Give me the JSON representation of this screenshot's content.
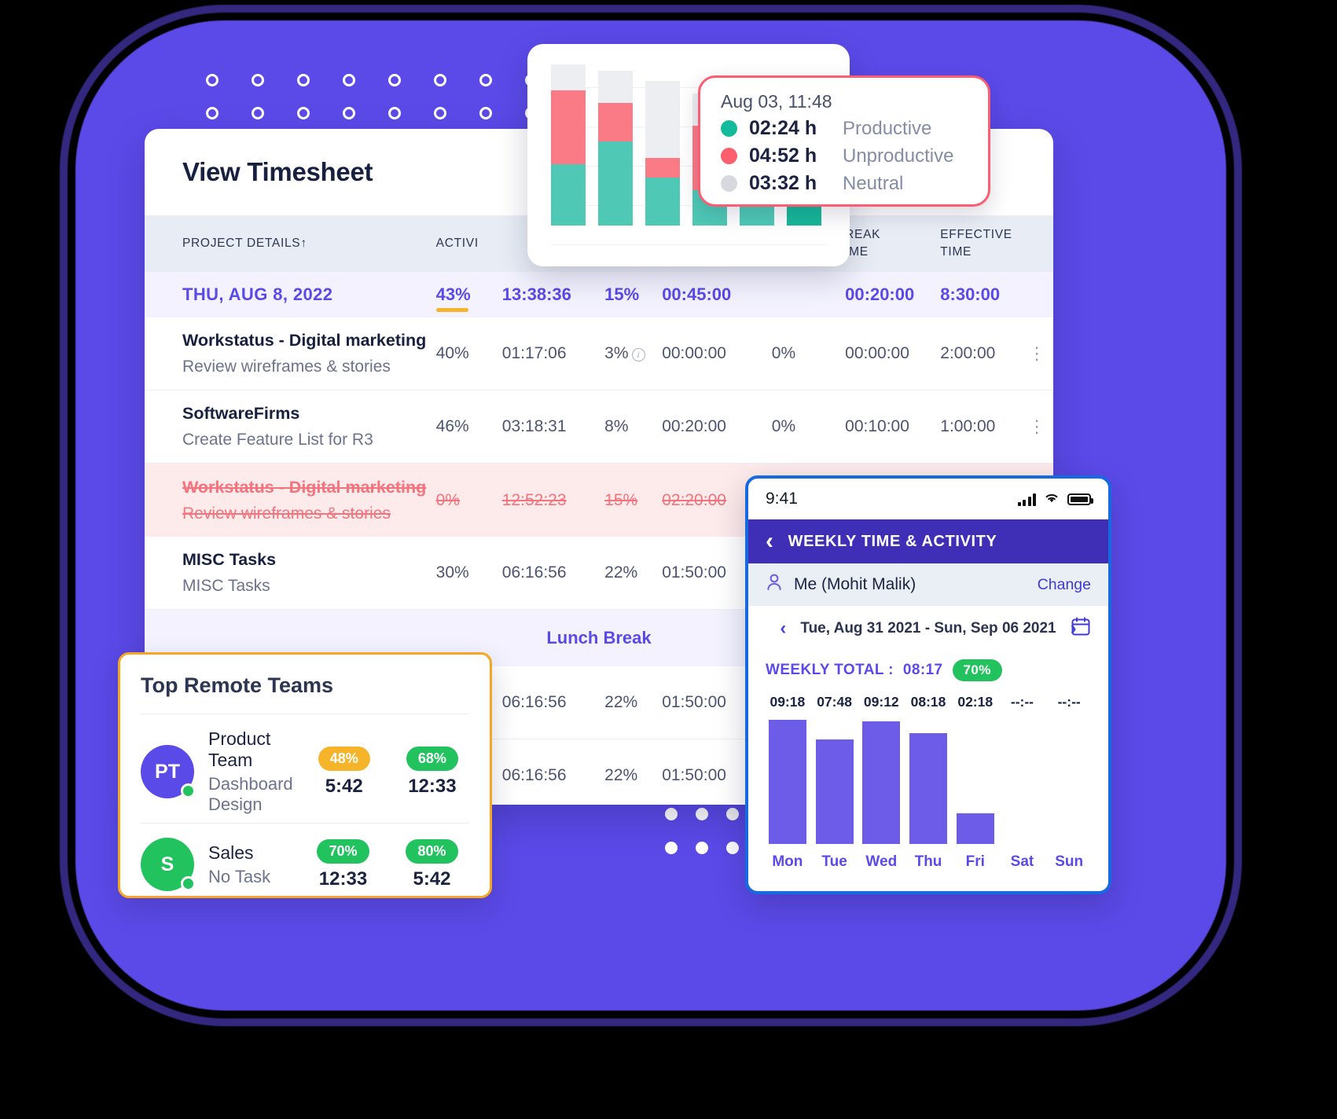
{
  "timesheet": {
    "title": "View Timesheet",
    "columns": {
      "project": "PROJECT DETAILS",
      "sort_arrow": "↑",
      "activity": "ACTIVI",
      "break_time": [
        "REAK",
        "IME"
      ],
      "effective_time": [
        "EFFECTIVE",
        "TIME"
      ]
    },
    "summary": {
      "label": "THU, AUG 8, 2022",
      "activity": "43%",
      "time": "13:38:36",
      "idle": "15%",
      "manual": "00:45:00",
      "manual_pct": "",
      "break": "00:20:00",
      "effective": "8:30:00"
    },
    "rows": [
      {
        "title": "Workstatus - Digital marketing",
        "subtitle": "Review wireframes & stories",
        "activity": "40%",
        "time": "01:17:06",
        "idle": "3%",
        "idle_info": true,
        "manual": "00:00:00",
        "manual_pct": "0%",
        "break": "00:00:00",
        "effective": "2:00:00",
        "menu": "⋮",
        "struck": false
      },
      {
        "title": "SoftwareFirms",
        "subtitle": "Create Feature List for R3",
        "activity": "46%",
        "time": "03:18:31",
        "idle": "8%",
        "idle_info": false,
        "manual": "00:20:00",
        "manual_pct": "0%",
        "break": "00:10:00",
        "effective": "1:00:00",
        "menu": "⋮",
        "struck": false
      },
      {
        "title": "Workstatus - Digital marketing",
        "subtitle": "Review wireframes & stories",
        "activity": "0%",
        "time": "12:52:23",
        "idle": "15%",
        "idle_info": false,
        "manual": "02:20:00",
        "manual_pct": "",
        "break": "",
        "effective": "",
        "menu": "",
        "struck": true
      },
      {
        "title": "MISC Tasks",
        "subtitle": "MISC Tasks",
        "activity": "30%",
        "time": "06:16:56",
        "idle": "22%",
        "idle_info": false,
        "manual": "01:50:00",
        "manual_pct": "",
        "break": "",
        "effective": "",
        "menu": "",
        "struck": false
      }
    ],
    "lunch_break_label": "Lunch Break",
    "extra_rows": [
      {
        "time": "06:16:56",
        "idle": "22%",
        "manual": "01:50:00"
      },
      {
        "time": "06:16:56",
        "idle": "22%",
        "manual": "01:50:00"
      }
    ]
  },
  "tooltip": {
    "date": "Aug 03, 11:48",
    "items": [
      {
        "value": "02:24 h",
        "label": "Productive",
        "color": "#13bb9c"
      },
      {
        "value": "04:52 h",
        "label": "Unproductive",
        "color": "#fb5f6d"
      },
      {
        "value": "03:32 h",
        "label": "Neutral",
        "color": "#d5d9de"
      }
    ],
    "border_color": "#fc5d72"
  },
  "chart_data": [
    {
      "type": "bar",
      "title": "",
      "stacked": true,
      "series": [
        {
          "name": "Productive",
          "color": "#4fc9b6",
          "values": [
            38,
            52,
            30,
            22,
            14,
            30
          ]
        },
        {
          "name": "Unproductive",
          "color": "#fa7a85",
          "values": [
            46,
            24,
            12,
            40,
            18,
            0
          ]
        },
        {
          "name": "Neutral",
          "color": "#eceef1",
          "values": [
            16,
            20,
            48,
            20,
            0,
            0
          ]
        }
      ],
      "categories": [
        "",
        "",
        "",
        "",
        "",
        ""
      ],
      "grid": true,
      "ylim": [
        0,
        100
      ]
    },
    {
      "type": "bar",
      "title": "WEEKLY TOTAL :",
      "categories": [
        "Mon",
        "Tue",
        "Wed",
        "Thu",
        "Fri",
        "Sat",
        "Sun"
      ],
      "value_labels": [
        "09:18",
        "07:48",
        "09:12",
        "08:18",
        "02:18",
        "--:--",
        "--:--"
      ],
      "values": [
        9.3,
        7.8,
        9.2,
        8.3,
        2.3,
        0,
        0
      ],
      "color": "#6c5ce7",
      "ylim": [
        0,
        10
      ],
      "grid": false
    }
  ],
  "phone": {
    "status": {
      "time": "9:41"
    },
    "appbar": {
      "back": "‹",
      "title": "WEEKLY TIME & ACTIVITY"
    },
    "user": {
      "name": "Me (Mohit Malik)",
      "change": "Change",
      "icon": "person-icon"
    },
    "range": {
      "prev": "‹",
      "text": "Tue, Aug 31 2021 - Sun, Sep 06 2021",
      "next": "›",
      "calendar_icon": "calendar-icon"
    },
    "total": {
      "label": "WEEKLY TOTAL :",
      "value": "08:17",
      "pill": "70%"
    }
  },
  "teams": {
    "title": "Top Remote Teams",
    "rows": [
      {
        "initials": "PT",
        "avatar_color": "#5a4ae8",
        "name": "Product Team",
        "task": "Dashboard Design",
        "stat1": {
          "badge": "48%",
          "badge_color": "#f5b429",
          "time": "5:42"
        },
        "stat2": {
          "badge": "68%",
          "badge_color": "#22c35e",
          "time": "12:33"
        }
      },
      {
        "initials": "S",
        "avatar_color": "#22c35e",
        "name": "Sales",
        "task": "No Task",
        "stat1": {
          "badge": "70%",
          "badge_color": "#22c35e",
          "time": "12:33"
        },
        "stat2": {
          "badge": "80%",
          "badge_color": "#22c35e",
          "time": "5:42"
        }
      }
    ]
  },
  "colors": {
    "brand_purple": "#5b4ae8",
    "accent_orange": "#f5a623",
    "danger_red": "#fc5d72",
    "success_green": "#22c35e",
    "phone_border": "#1769e0"
  }
}
